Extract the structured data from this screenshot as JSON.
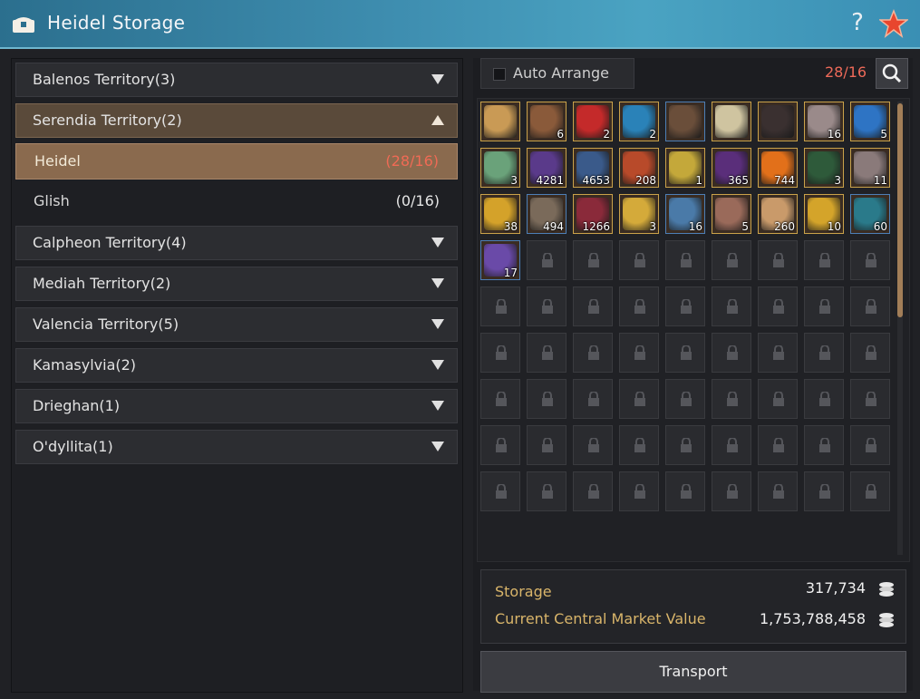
{
  "window": {
    "title": "Heidel Storage",
    "help_label": "?",
    "icons": [
      "chest-icon",
      "question-icon",
      "star-icon"
    ]
  },
  "territories": [
    {
      "label": "Balenos Territory(3)",
      "open": false
    },
    {
      "label": "Serendia Territory(2)",
      "open": true
    },
    {
      "label": "Calpheon Territory(4)",
      "open": false
    },
    {
      "label": "Mediah Territory(2)",
      "open": false
    },
    {
      "label": "Valencia Territory(5)",
      "open": false
    },
    {
      "label": "Kamasylvia(2)",
      "open": false
    },
    {
      "label": "Drieghan(1)",
      "open": false
    },
    {
      "label": "O'dyllita(1)",
      "open": false
    }
  ],
  "serendia_towns": [
    {
      "label": "Heidel",
      "count": "(28/16)",
      "selected": true
    },
    {
      "label": "Glish",
      "count": "(0/16)",
      "selected": false
    }
  ],
  "toolbar": {
    "auto_arrange_label": "Auto Arrange",
    "auto_arrange_checked": false,
    "capacity": "28/16"
  },
  "items": [
    {
      "qty": "",
      "color": "#c99a55",
      "frame": "gold"
    },
    {
      "qty": "6",
      "color": "#8a5a3a",
      "frame": "gold"
    },
    {
      "qty": "2",
      "color": "#c42a2a",
      "frame": "gold"
    },
    {
      "qty": "2",
      "color": "#2a82b8",
      "frame": "gold"
    },
    {
      "qty": "",
      "color": "#6a4e3a",
      "frame": "blue"
    },
    {
      "qty": "",
      "color": "#cfc4a0",
      "frame": "gold"
    },
    {
      "qty": "",
      "color": "#3a3030",
      "frame": "gold"
    },
    {
      "qty": "16",
      "color": "#9a8a8a",
      "frame": "gold"
    },
    {
      "qty": "5",
      "color": "#2e74c4",
      "frame": "gold"
    },
    {
      "qty": "3",
      "color": "#6aa27a",
      "frame": "gold"
    },
    {
      "qty": "4281",
      "color": "#5a3a8a",
      "frame": "gold"
    },
    {
      "qty": "4653",
      "color": "#3a5a8a",
      "frame": "gold"
    },
    {
      "qty": "208",
      "color": "#b84a2a",
      "frame": "gold"
    },
    {
      "qty": "1",
      "color": "#c4a83a",
      "frame": "gold"
    },
    {
      "qty": "365",
      "color": "#5a2e7a",
      "frame": "gold"
    },
    {
      "qty": "744",
      "color": "#e2701a",
      "frame": "gold"
    },
    {
      "qty": "3",
      "color": "#2e5a3a",
      "frame": "gold"
    },
    {
      "qty": "11",
      "color": "#8a7a7a",
      "frame": "gold"
    },
    {
      "qty": "38",
      "color": "#d4a22a",
      "frame": "gold"
    },
    {
      "qty": "494",
      "color": "#7a6a5a",
      "frame": "blue"
    },
    {
      "qty": "1266",
      "color": "#8a2a3a",
      "frame": "gold"
    },
    {
      "qty": "3",
      "color": "#d4aa3a",
      "frame": "gold"
    },
    {
      "qty": "16",
      "color": "#4a7aa8",
      "frame": "blue"
    },
    {
      "qty": "5",
      "color": "#9a6a5a",
      "frame": "gold"
    },
    {
      "qty": "260",
      "color": "#c99a6a",
      "frame": "gold"
    },
    {
      "qty": "10",
      "color": "#d4a42a",
      "frame": "gold"
    },
    {
      "qty": "60",
      "color": "#2a7a8a",
      "frame": "blue"
    },
    {
      "qty": "17",
      "color": "#6a4aa8",
      "frame": "blue"
    }
  ],
  "locked_slots_visible": 53,
  "summary": {
    "storage_label": "Storage",
    "storage_value": "317,734",
    "market_label": "Current Central Market Value",
    "market_value": "1,753,788,458"
  },
  "transport_label": "Transport"
}
